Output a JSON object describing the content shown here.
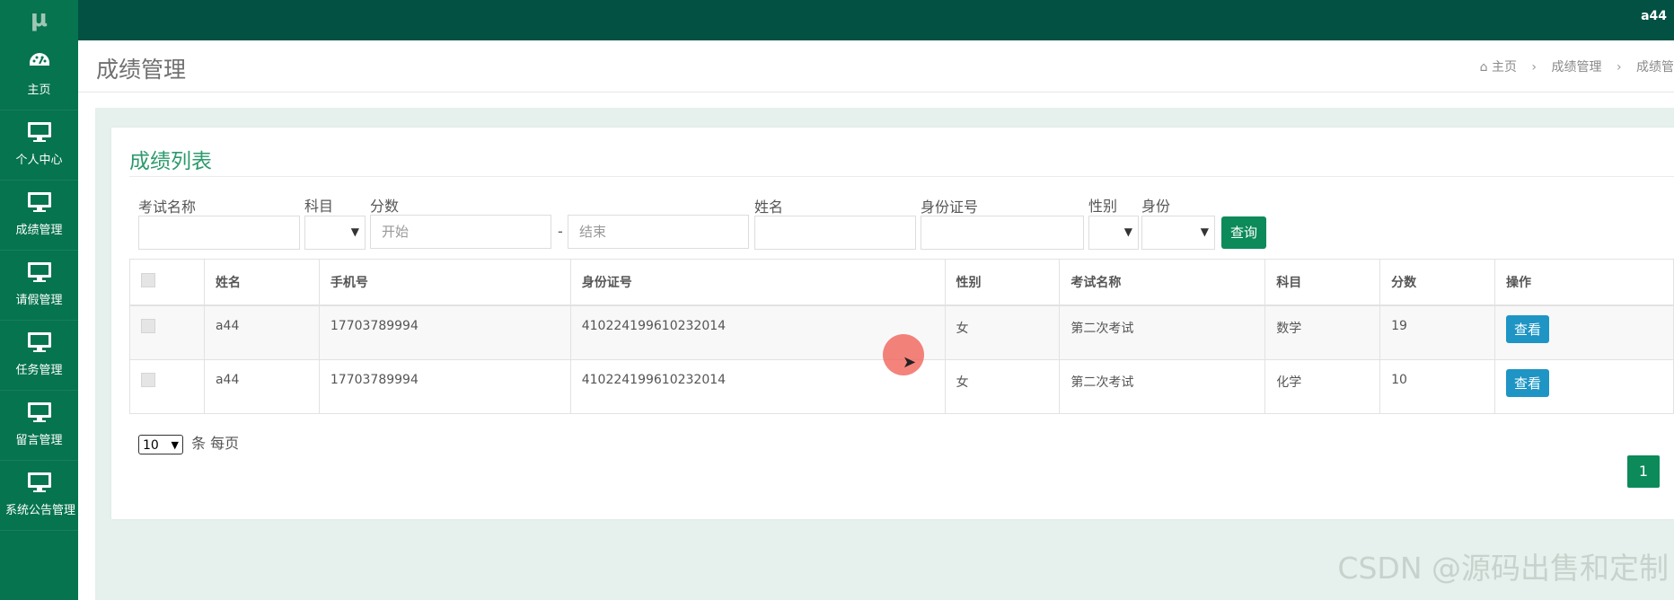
{
  "app": {
    "logo": "μ",
    "user": "a44"
  },
  "sidebar": {
    "items": [
      {
        "label": "主页",
        "icon": "dashboard-icon"
      },
      {
        "label": "个人中心",
        "icon": "monitor-icon"
      },
      {
        "label": "成绩管理",
        "icon": "monitor-icon"
      },
      {
        "label": "请假管理",
        "icon": "monitor-icon"
      },
      {
        "label": "任务管理",
        "icon": "monitor-icon"
      },
      {
        "label": "留言管理",
        "icon": "monitor-icon"
      },
      {
        "label": "系统公告管理",
        "icon": "monitor-icon"
      }
    ]
  },
  "header": {
    "title": "成绩管理",
    "breadcrumb": {
      "home": "主页",
      "level1": "成绩管理",
      "level2": "成绩管"
    }
  },
  "card": {
    "title": "成绩列表"
  },
  "filters": {
    "exam_name_label": "考试名称",
    "subject_label": "科目",
    "score_label": "分数",
    "score_start_placeholder": "开始",
    "score_sep": "-",
    "score_end_placeholder": "结束",
    "name_label": "姓名",
    "idcard_label": "身份证号",
    "gender_label": "性别",
    "identity_label": "身份",
    "query_button": "查询"
  },
  "table": {
    "columns": [
      "姓名",
      "手机号",
      "身份证号",
      "性别",
      "考试名称",
      "科目",
      "分数",
      "操作"
    ],
    "rows": [
      {
        "name": "a44",
        "phone": "17703789994",
        "idcard": "410224199610232014",
        "gender": "女",
        "exam": "第二次考试",
        "subject": "数学",
        "score": "19",
        "action": "查看"
      },
      {
        "name": "a44",
        "phone": "17703789994",
        "idcard": "410224199610232014",
        "gender": "女",
        "exam": "第二次考试",
        "subject": "化学",
        "score": "10",
        "action": "查看"
      }
    ]
  },
  "pagination": {
    "page_size": "10",
    "page_size_suffix": "条 每页",
    "current_page": "1"
  },
  "watermark": "CSDN @源码出售和定制",
  "colors": {
    "topbar": "#025143",
    "sidebar": "#06744f",
    "accent": "#0c8a5a",
    "view_button": "#1e95c4",
    "content_bg": "#e6f0ec"
  }
}
